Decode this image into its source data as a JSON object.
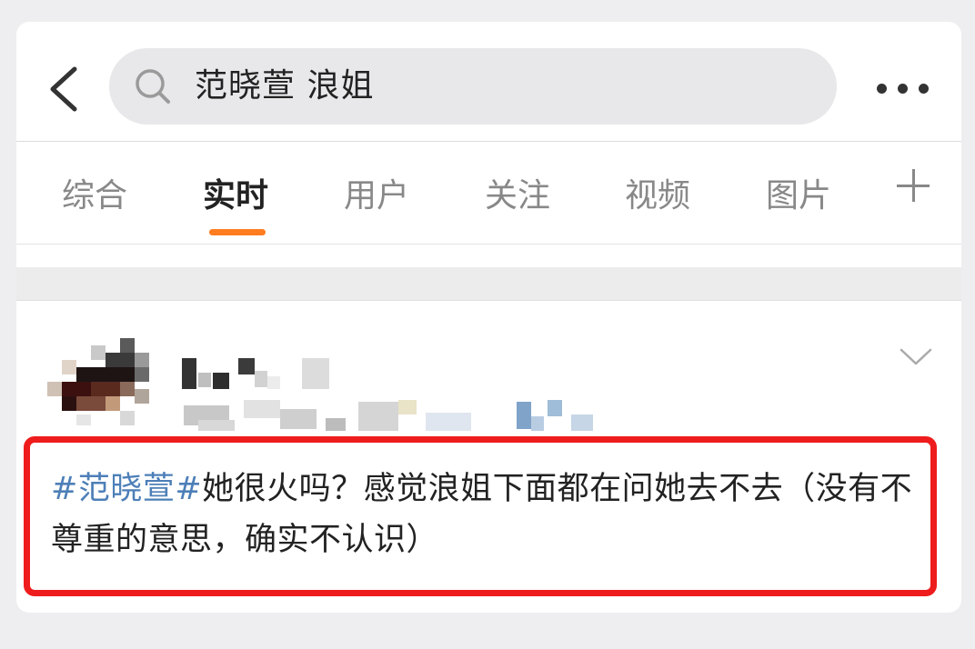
{
  "search": {
    "query": "范晓萱 浪姐"
  },
  "tabs": [
    {
      "label": "综合",
      "active": false
    },
    {
      "label": "实时",
      "active": true
    },
    {
      "label": "用户",
      "active": false
    },
    {
      "label": "关注",
      "active": false
    },
    {
      "label": "视频",
      "active": false
    },
    {
      "label": "图片",
      "active": false
    }
  ],
  "icons": {
    "back": "back-arrow-icon",
    "search": "search-icon",
    "more": "more-dots-icon",
    "add_tab": "plus-icon",
    "expand": "chevron-down-icon"
  },
  "post": {
    "hashtag": "#范晓萱#",
    "body": "她很火吗？感觉浪姐下面都在问她去不去（没有不尊重的意思，确实不认识）"
  },
  "colors": {
    "accent_underline": "#ff7d1f",
    "hashtag": "#4d7fb8",
    "highlight_border": "#ee1c1c"
  }
}
